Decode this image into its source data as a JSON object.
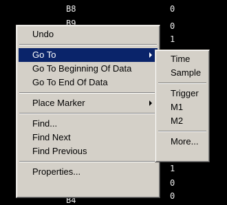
{
  "background_rows": [
    {
      "label": "B8",
      "value": "0"
    },
    {
      "label": "B9",
      "value": "0"
    },
    {
      "label": "",
      "value": "1"
    },
    {
      "label": "",
      "value": "1"
    },
    {
      "label": "",
      "value": "0"
    },
    {
      "label": "B4",
      "value": "0"
    }
  ],
  "context_menu": {
    "undo": "Undo",
    "go_to": "Go To",
    "go_to_beginning": "Go To Beginning Of Data",
    "go_to_end": "Go To End Of Data",
    "place_marker": "Place Marker",
    "find": "Find...",
    "find_next": "Find Next",
    "find_previous": "Find Previous",
    "properties": "Properties..."
  },
  "go_to_submenu": {
    "time": "Time",
    "sample": "Sample",
    "trigger": "Trigger",
    "m1": "M1",
    "m2": "M2",
    "more": "More..."
  },
  "colors": {
    "background": "#000000",
    "menu_face": "#d4d0c8",
    "highlight": "#0a246a",
    "highlight_text": "#ffffff"
  }
}
